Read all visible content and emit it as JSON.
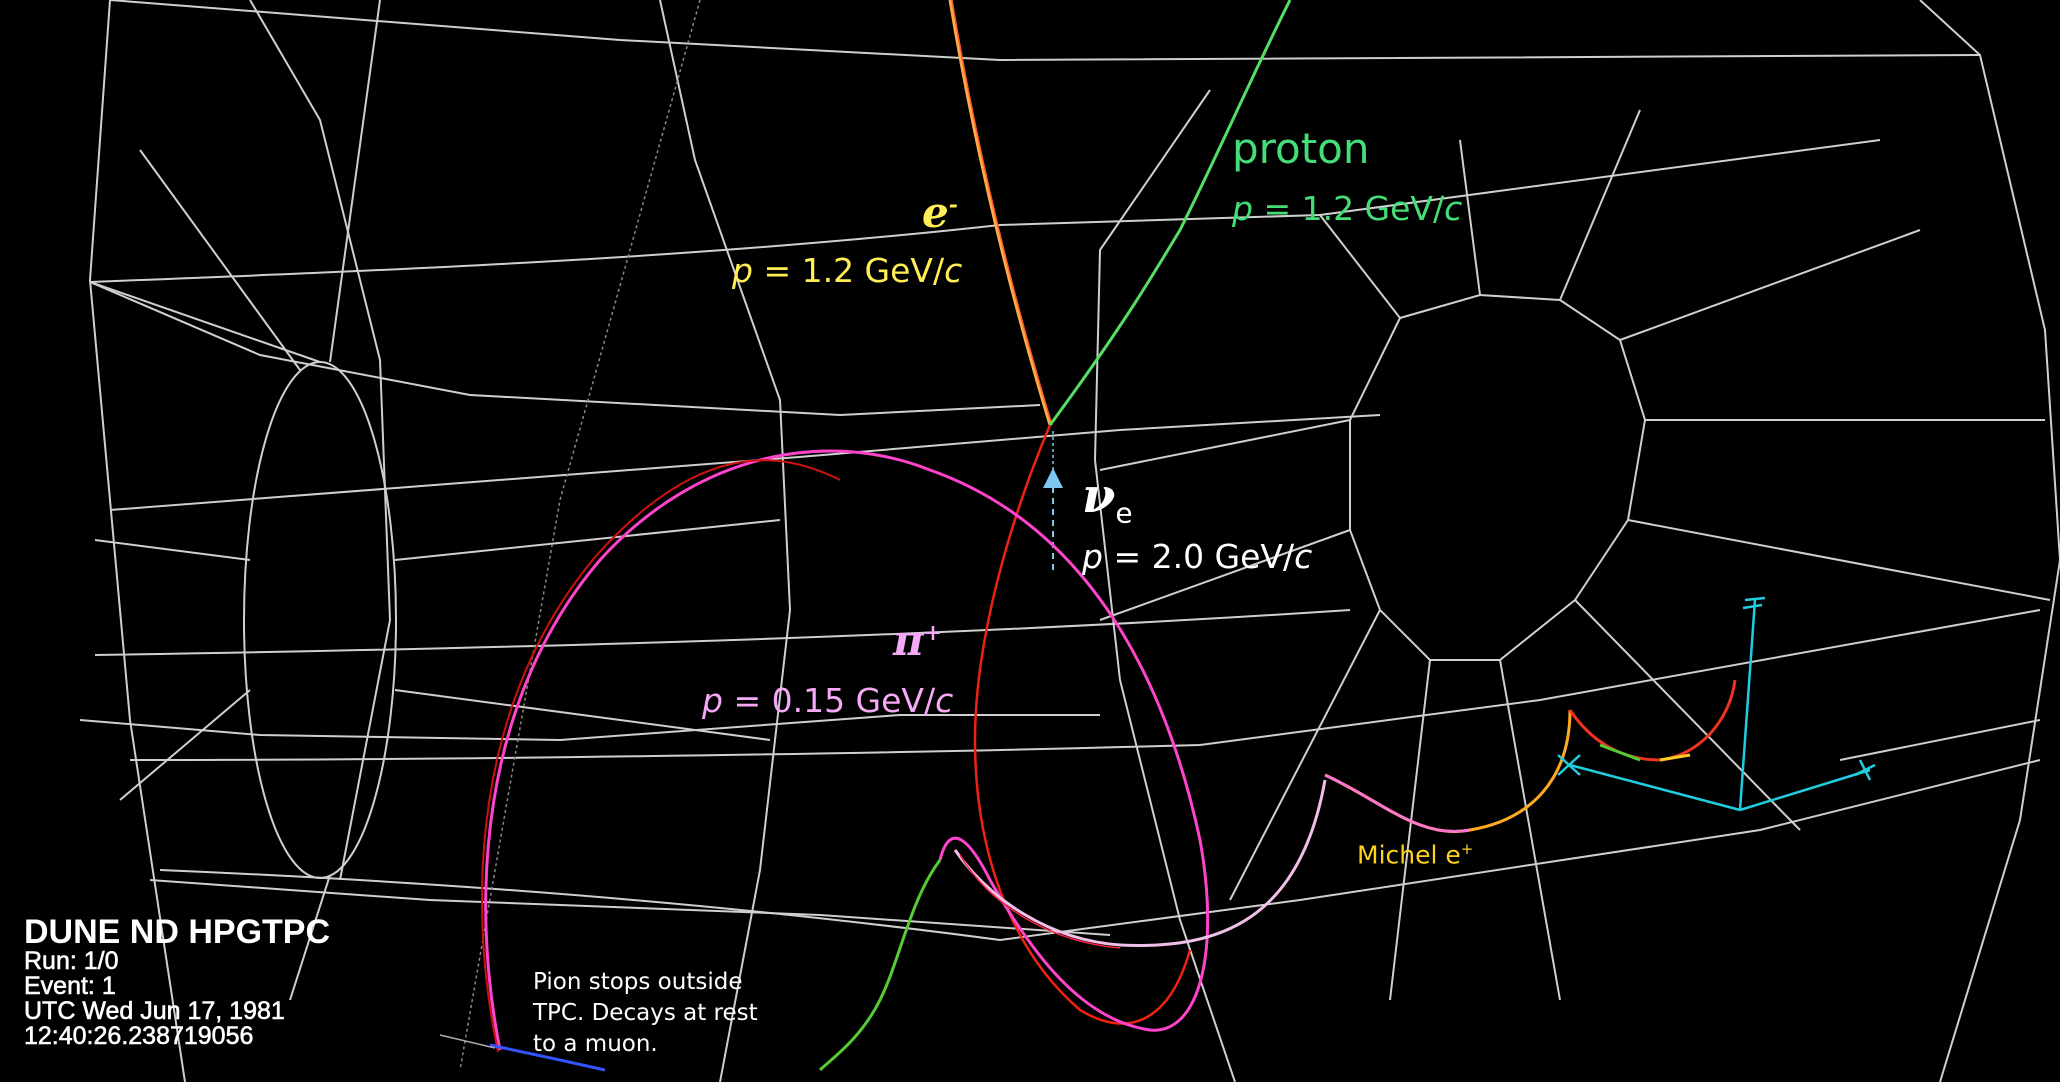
{
  "info": {
    "title": "DUNE ND HPGTPC",
    "run": "Run:   1/0",
    "event": "Event: 1",
    "utc": "UTC Wed Jun 17, 1981",
    "time": "12:40:26.238719056"
  },
  "labels": {
    "electron": {
      "name": "e",
      "sup": "-",
      "momentum_prefix": "p",
      "momentum_value": " = 1.2 GeV/",
      "momentum_unit": "c",
      "color": "#ffee55"
    },
    "proton": {
      "name": "proton",
      "momentum_prefix": "p",
      "momentum_value": " = 1.2 GeV/",
      "momentum_unit": "c",
      "color": "#44dd77"
    },
    "neutrino": {
      "name": "ν",
      "sub": "e",
      "momentum_prefix": "p",
      "momentum_value": " = 2.0 GeV/",
      "momentum_unit": "c",
      "color": "#ffffff"
    },
    "pion": {
      "name": "π",
      "sup": "+",
      "momentum_prefix": "p",
      "momentum_value": " = 0.15 GeV/",
      "momentum_unit": "c",
      "color": "#f5a8f5"
    },
    "michel": {
      "text": "Michel e",
      "sup": "+",
      "color": "#ffd21a"
    }
  },
  "note": [
    "Pion stops outside",
    "TPC.  Decays at rest",
    "to a muon."
  ],
  "colors": {
    "background": "#000000",
    "wireframe": "#cfcfcf",
    "axes": "#22cce0",
    "neutrino_arrow": "#7cc8f0"
  }
}
